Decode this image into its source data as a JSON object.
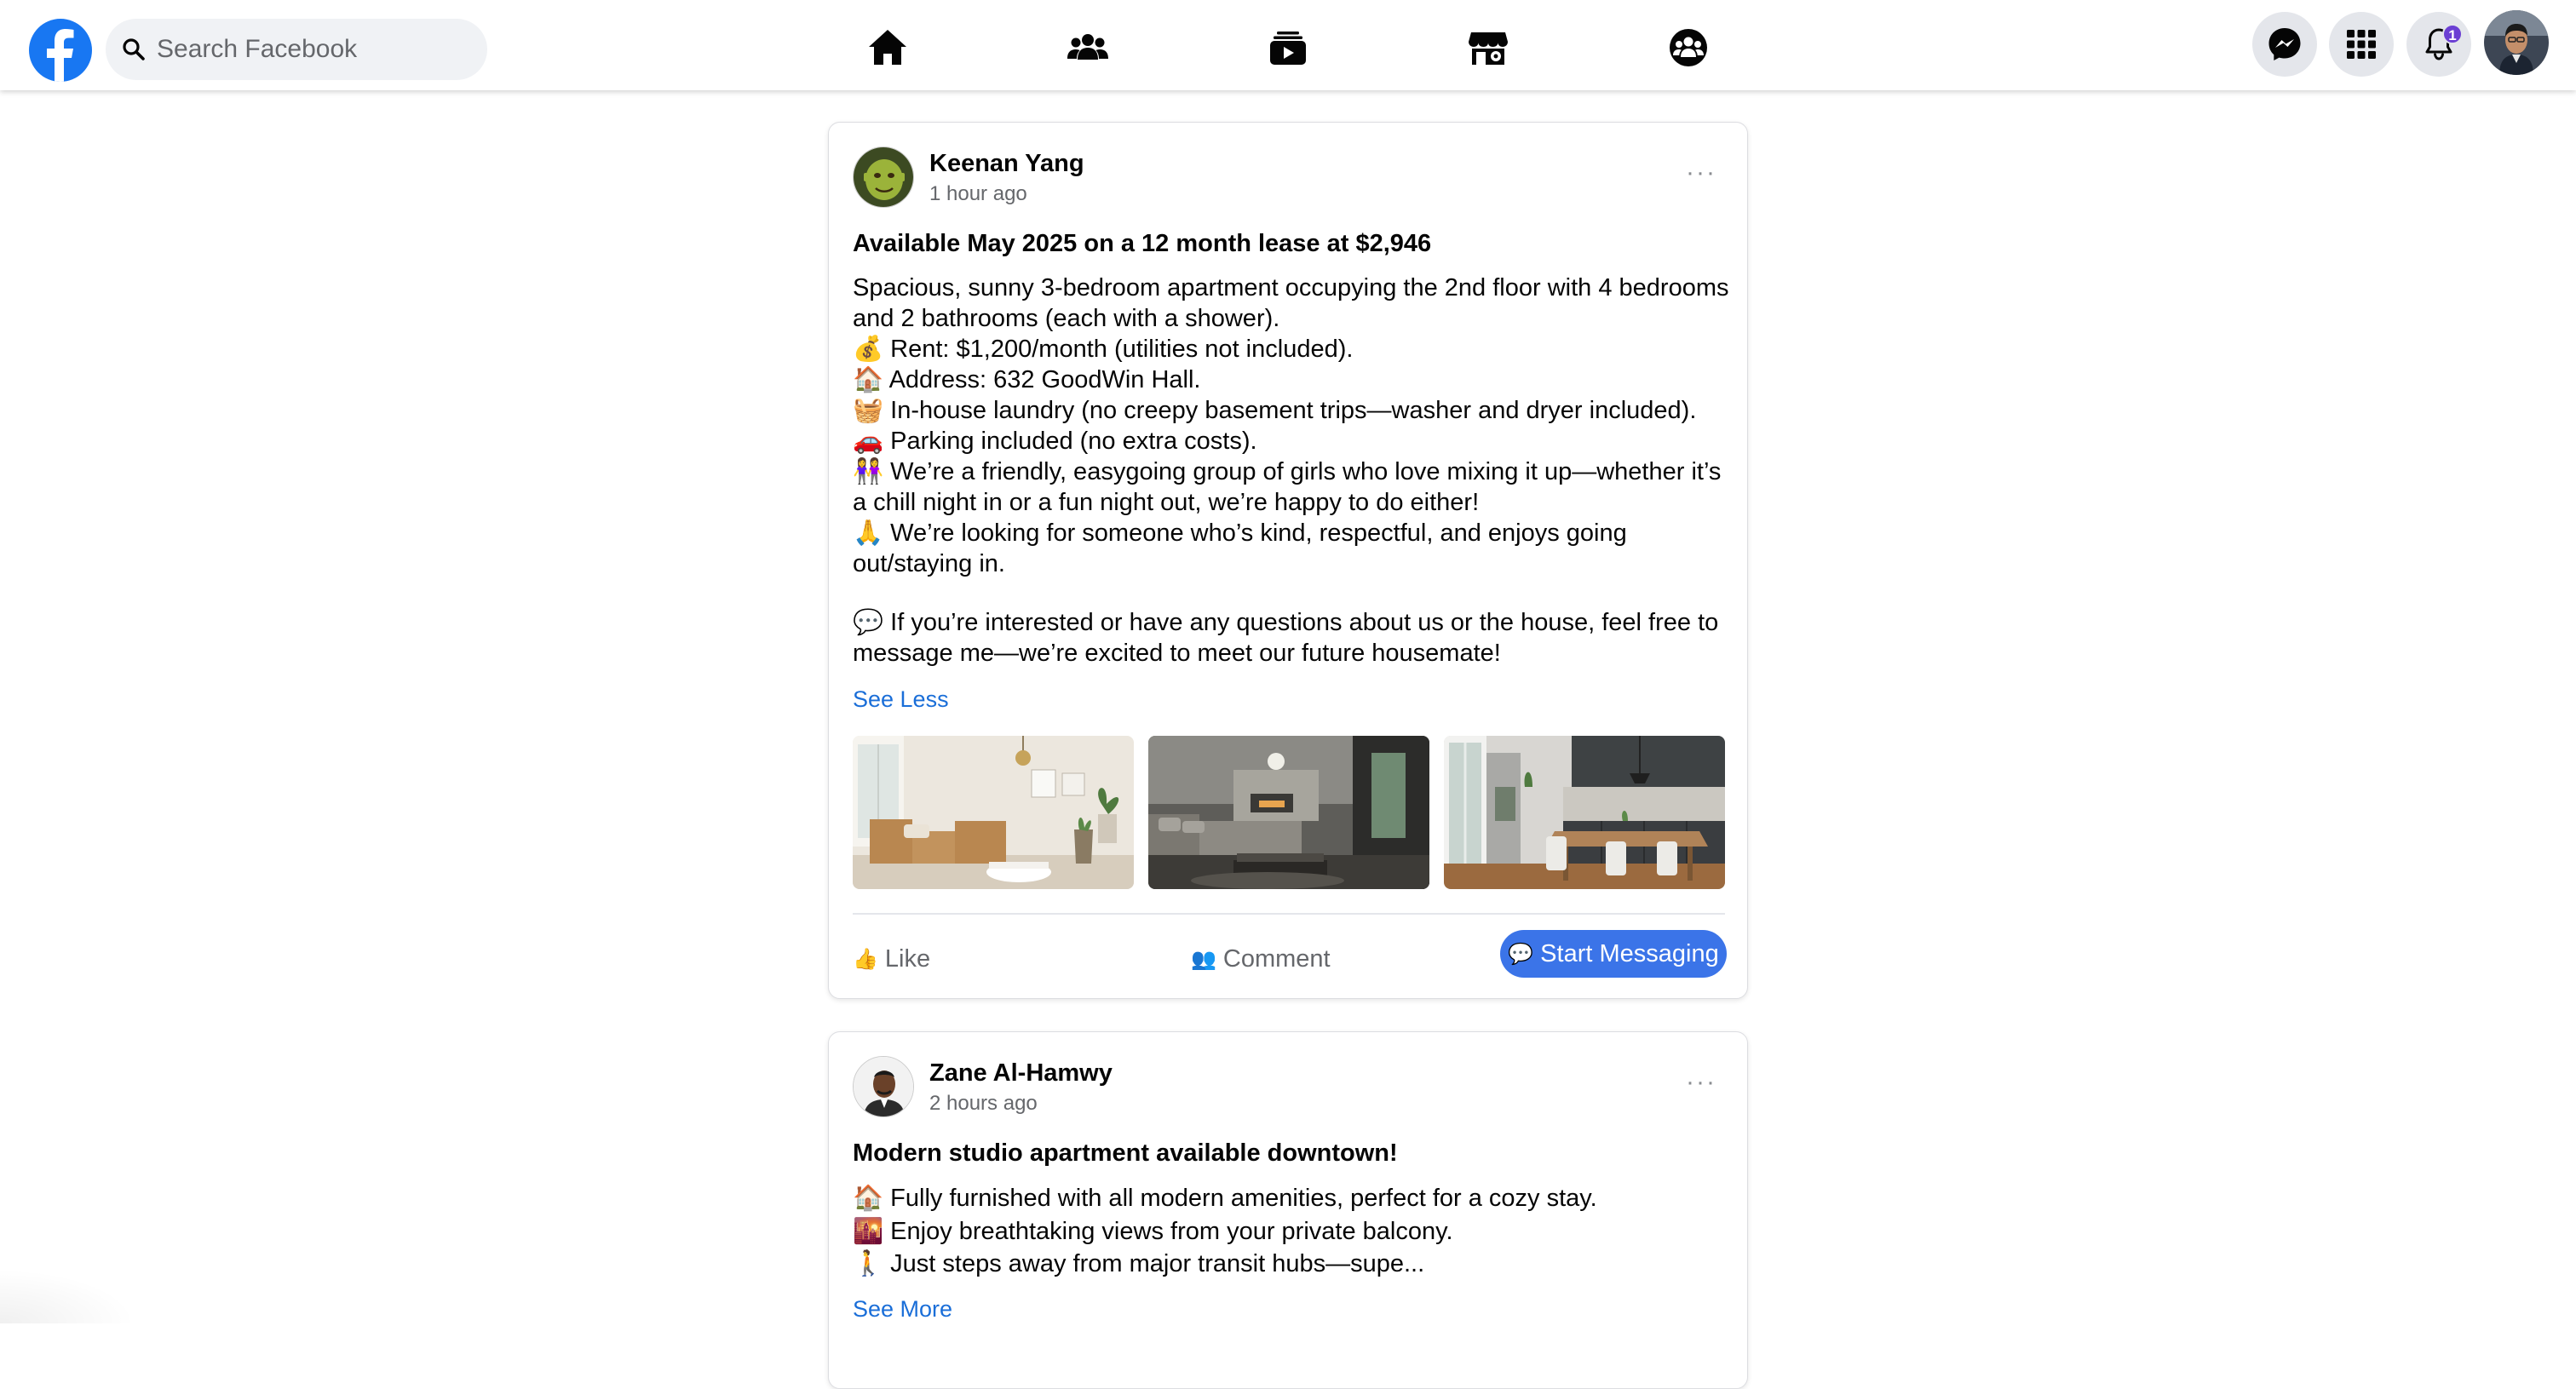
{
  "header": {
    "search_placeholder": "Search Facebook",
    "nav_icons": [
      "home-icon",
      "friends-icon",
      "watch-icon",
      "marketplace-icon",
      "groups-icon"
    ],
    "right_icons": [
      "messenger-icon",
      "menu-grid-icon",
      "notifications-bell-icon"
    ],
    "notification_count": "1"
  },
  "colors": {
    "brand": "#1877f2",
    "link": "#1a6ed8",
    "message_button": "#3b74e8",
    "badge": "#6b3fd3"
  },
  "posts": [
    {
      "author": "Keenan Yang",
      "time": "1 hour ago",
      "title": "Available May 2025 on a 12 month lease at $2,946",
      "lines": [
        "Spacious, sunny 3-bedroom apartment occupying the 2nd floor with 4 bedrooms and 2 bathrooms (each with a shower).",
        "💰 Rent: $1,200/month (utilities not included).",
        "🏠 Address: 632 GoodWin Hall.",
        "🧺 In-house laundry (no creepy basement trips—washer and dryer included).",
        "🚗 Parking included (no extra costs).",
        "👭 We’re a friendly, easygoing group of girls who love mixing it up—whether it’s a chill night in or a fun night out, we’re happy to do either!",
        "🙏 We’re looking for someone who’s kind, respectful, and enjoys going out/staying in."
      ],
      "closing": "💬 If you’re interested or have any questions about us or the house, feel free to message me—we’re excited to meet our future housemate!",
      "toggle_label": "See Less",
      "photos": [
        "living-room-photo",
        "lounge-photo",
        "kitchen-dining-photo"
      ],
      "like_label": "Like",
      "like_icon": "👍",
      "comment_label": "Comment",
      "comment_icon": "👥",
      "message_label": "Start Messaging",
      "message_icon": "💬"
    },
    {
      "author": "Zane Al-Hamwy",
      "time": "2 hours ago",
      "title": "Modern studio apartment available downtown!",
      "lines": [
        "🏠 Fully furnished with all modern amenities, perfect for a cozy stay.",
        "🌇 Enjoy breathtaking views from your private balcony.",
        "🚶 Just steps away from major transit hubs—supe..."
      ],
      "toggle_label": "See More"
    }
  ]
}
